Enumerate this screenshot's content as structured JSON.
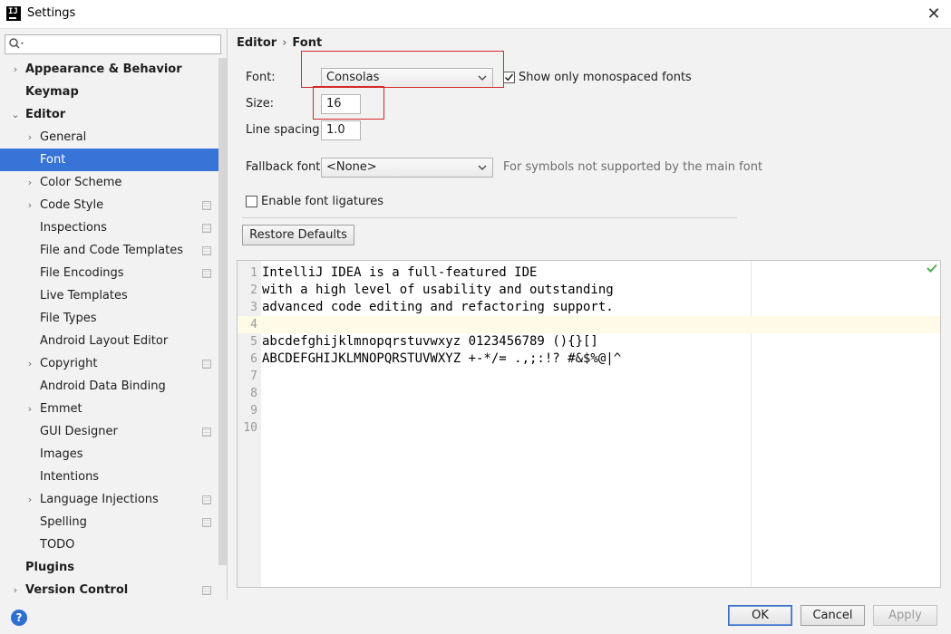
{
  "window": {
    "title": "Settings",
    "app_icon_text": "IJ"
  },
  "search": {
    "value": "",
    "placeholder": ""
  },
  "sidebar": {
    "items": [
      {
        "label": "Appearance & Behavior",
        "level": 0,
        "arrow": "right",
        "bold": true
      },
      {
        "label": "Keymap",
        "level": 0,
        "arrow": "none",
        "bold": true
      },
      {
        "label": "Editor",
        "level": 0,
        "arrow": "down",
        "bold": true
      },
      {
        "label": "General",
        "level": 1,
        "arrow": "right"
      },
      {
        "label": "Font",
        "level": 1,
        "arrow": "none",
        "selected": true
      },
      {
        "label": "Color Scheme",
        "level": 1,
        "arrow": "right"
      },
      {
        "label": "Code Style",
        "level": 1,
        "arrow": "right",
        "project_icon": true
      },
      {
        "label": "Inspections",
        "level": 1,
        "arrow": "none",
        "project_icon": true
      },
      {
        "label": "File and Code Templates",
        "level": 1,
        "arrow": "none",
        "project_icon": true
      },
      {
        "label": "File Encodings",
        "level": 1,
        "arrow": "none",
        "project_icon": true
      },
      {
        "label": "Live Templates",
        "level": 1,
        "arrow": "none"
      },
      {
        "label": "File Types",
        "level": 1,
        "arrow": "none"
      },
      {
        "label": "Android Layout Editor",
        "level": 1,
        "arrow": "none"
      },
      {
        "label": "Copyright",
        "level": 1,
        "arrow": "right",
        "project_icon": true
      },
      {
        "label": "Android Data Binding",
        "level": 1,
        "arrow": "none"
      },
      {
        "label": "Emmet",
        "level": 1,
        "arrow": "right"
      },
      {
        "label": "GUI Designer",
        "level": 1,
        "arrow": "none",
        "project_icon": true
      },
      {
        "label": "Images",
        "level": 1,
        "arrow": "none"
      },
      {
        "label": "Intentions",
        "level": 1,
        "arrow": "none"
      },
      {
        "label": "Language Injections",
        "level": 1,
        "arrow": "right",
        "project_icon": true
      },
      {
        "label": "Spelling",
        "level": 1,
        "arrow": "none",
        "project_icon": true
      },
      {
        "label": "TODO",
        "level": 1,
        "arrow": "none"
      },
      {
        "label": "Plugins",
        "level": 0,
        "arrow": "none",
        "bold": true
      },
      {
        "label": "Version Control",
        "level": 0,
        "arrow": "right",
        "bold": true,
        "project_icon": true
      }
    ]
  },
  "breadcrumb": {
    "parent": "Editor",
    "separator": "›",
    "current": "Font"
  },
  "font_settings": {
    "font_label": "Font:",
    "font_value": "Consolas",
    "monospaced_label": "Show only monospaced fonts",
    "monospaced_checked": true,
    "size_label": "Size:",
    "size_value": "16",
    "line_spacing_label": "Line spacing:",
    "line_spacing_value": "1.0",
    "fallback_label": "Fallback font:",
    "fallback_value": "<None>",
    "fallback_hint": "For symbols not supported by the main font",
    "ligatures_label": "Enable font ligatures",
    "ligatures_checked": false,
    "restore_label": "Restore Defaults"
  },
  "preview": {
    "current_line": 4,
    "lines": [
      {
        "num": "1",
        "text": "IntelliJ IDEA is a full-featured IDE"
      },
      {
        "num": "2",
        "text": "with a high level of usability and outstanding"
      },
      {
        "num": "3",
        "text": "advanced code editing and refactoring support."
      },
      {
        "num": "4",
        "text": ""
      },
      {
        "num": "5",
        "text": "abcdefghijklmnopqrstuvwxyz 0123456789 (){}[]"
      },
      {
        "num": "6",
        "text": "ABCDEFGHIJKLMNOPQRSTUVWXYZ +-*/= .,;:!? #&$%@|^"
      },
      {
        "num": "7",
        "text": ""
      },
      {
        "num": "8",
        "text": ""
      },
      {
        "num": "9",
        "text": ""
      },
      {
        "num": "10",
        "text": ""
      }
    ]
  },
  "footer": {
    "help": "?",
    "ok": "OK",
    "cancel": "Cancel",
    "apply": "Apply"
  },
  "colors": {
    "selection": "#3874d8",
    "annotation_red": "#d62a2a",
    "current_line": "#fffbe6",
    "help_blue": "#2f6fd1"
  }
}
